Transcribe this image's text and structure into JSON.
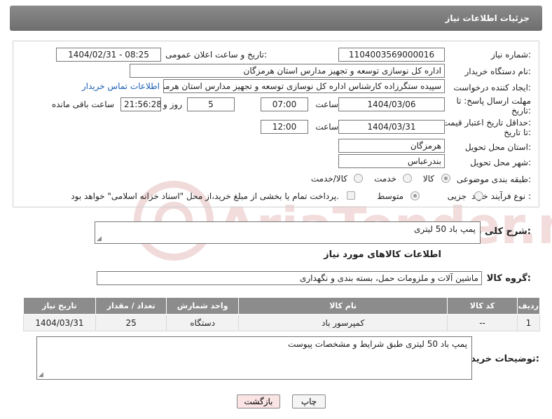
{
  "header": {
    "title": "جزئیات اطلاعات نیاز"
  },
  "form": {
    "need_number": {
      "label": "شماره نیاز:",
      "value": "1104003569000016"
    },
    "announce_datetime": {
      "label": "تاریخ و ساعت اعلان عمومی:",
      "value": "1404/02/31 - 08:25"
    },
    "buyer_org": {
      "label": "نام دستگاه خریدار:",
      "value": "اداره کل نوسازی  توسعه و تجهیز مدارس استان هرمزگان"
    },
    "requester": {
      "label": "ایجاد کننده درخواست:",
      "value": "سپیده ستگرزاده کارشناس اداره کل نوسازی  توسعه و تجهیز مدارس استان هرمزگان",
      "contact_link": "اطلاعات تماس خریدار"
    },
    "response_deadline": {
      "label_line1": "مهلت ارسال پاسخ: تا",
      "label_line2": "تاریخ:",
      "date": "1404/03/06",
      "time_label": "ساعت",
      "time": "07:00",
      "days": "5",
      "days_label": "روز و",
      "remaining": "21:56:28",
      "remaining_label": "ساعت باقی مانده"
    },
    "price_validity": {
      "label_line1": "حداقل تاریخ اعتبار قیمت:",
      "label_line2": "تا تاریخ:",
      "date": "1404/03/31",
      "time_label": "ساعت",
      "time": "12:00"
    },
    "delivery_province": {
      "label": "استان محل تحویل:",
      "value": "هرمزگان"
    },
    "delivery_city": {
      "label": "شهر محل تحویل:",
      "value": "بندرعباس"
    },
    "category": {
      "label": "طبقه بندی موضوعی:",
      "options": [
        "کالا",
        "خدمت",
        "کالا/خدمت"
      ],
      "selected": "کالا"
    },
    "purchase_type": {
      "label": "نوع فرآیند خرید :",
      "options": [
        "جزیی",
        "متوسط"
      ],
      "selected": "متوسط",
      "payment_note": "پرداخت تمام یا بخشی از مبلغ خرید،از محل \"اسناد خزانه اسلامی\" خواهد بود."
    }
  },
  "summary": {
    "label": "شرح کلی نیاز:",
    "value": "پمپ باد 50 لیتری"
  },
  "goods_section": {
    "title": "اطلاعات کالاهای مورد نیاز"
  },
  "goods_group": {
    "label": "گروه کالا:",
    "value": "ماشین آلات و ملزومات حمل، بسته بندی و نگهداری"
  },
  "items_table": {
    "headers": [
      "ردیف",
      "کد کالا",
      "نام کالا",
      "واحد شمارش",
      "تعداد / مقدار",
      "تاریخ نیاز"
    ],
    "rows": [
      [
        "1",
        "--",
        "کمپرسور باد",
        "دستگاه",
        "25",
        "1404/03/31"
      ]
    ]
  },
  "buyer_notes": {
    "label": "توضیحات خریدار:",
    "value": "پمپ باد 50 لیتری  طبق شرایط و مشخصات پیوست"
  },
  "buttons": {
    "print": "چاپ",
    "back": "بازگشت"
  },
  "watermark": {
    "text": "AriaTender.net"
  },
  "colors": {
    "header_bg": "#7a7a7a",
    "link": "#1a5fb4",
    "back_button_bg": "#fbe4e4"
  }
}
